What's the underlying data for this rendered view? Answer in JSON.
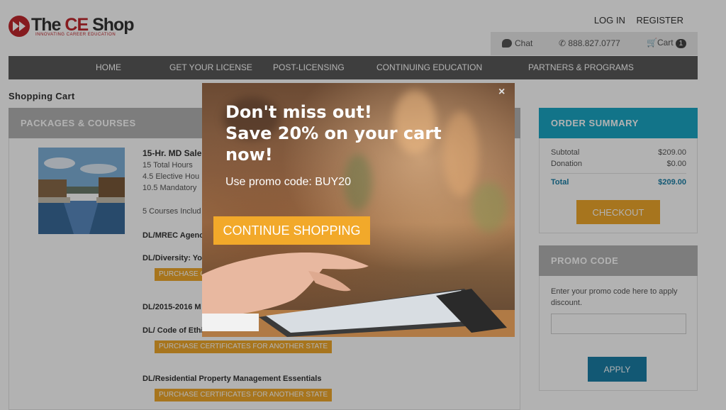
{
  "header": {
    "brand_the": "The",
    "brand_ce": "CE",
    "brand_shop": "Shop",
    "tagline": "INNOVATING CAREER EDUCATION",
    "login": "LOG IN",
    "register": "REGISTER",
    "chat": "Chat",
    "phone": "888.827.0777",
    "cart": "Cart",
    "cart_count": "1"
  },
  "nav": [
    "HOME",
    "GET YOUR LICENSE",
    "POST-LICENSING",
    "CONTINUING EDUCATION",
    "PARTNERS & PROGRAMS"
  ],
  "page_title": "Shopping Cart",
  "packages": {
    "heading": "PACKAGES & COURSES",
    "course_title": "15-Hr. MD Sale",
    "lines": [
      "15 Total Hours",
      "4.5 Elective Hou",
      "10.5 Mandatory",
      "5 Courses Includ"
    ],
    "subcourses": [
      "DL/MREC Agency",
      "DL/Diversity: You",
      "DL/2015-2016 M",
      "DL/ Code of Ethi",
      "DL/Residential Property Management Essentials"
    ],
    "cert_button_short": "PURCHASE CE",
    "cert_button": "PURCHASE CERTIFICATES FOR ANOTHER STATE"
  },
  "order_summary": {
    "heading": "ORDER SUMMARY",
    "subtotal_label": "Subtotal",
    "subtotal_value": "$209.00",
    "donation_label": "Donation",
    "donation_value": "$0.00",
    "total_label": "Total",
    "total_value": "$209.00",
    "checkout": "CHECKOUT"
  },
  "promo": {
    "heading": "PROMO CODE",
    "text": "Enter your promo code here to apply discount.",
    "input_value": "",
    "apply": "APPLY"
  },
  "modal": {
    "close": "×",
    "line1": "Don't miss out!",
    "line2": "Save 20% on your cart",
    "line3": "now!",
    "code_text": "Use promo code: BUY20",
    "continue": "CONTINUE SHOPPING"
  },
  "colors": {
    "accent_orange": "#f0a82b",
    "accent_blue": "#1aa6c5",
    "nav_bg": "#5a5a5a",
    "brand_red": "#c0272d"
  }
}
